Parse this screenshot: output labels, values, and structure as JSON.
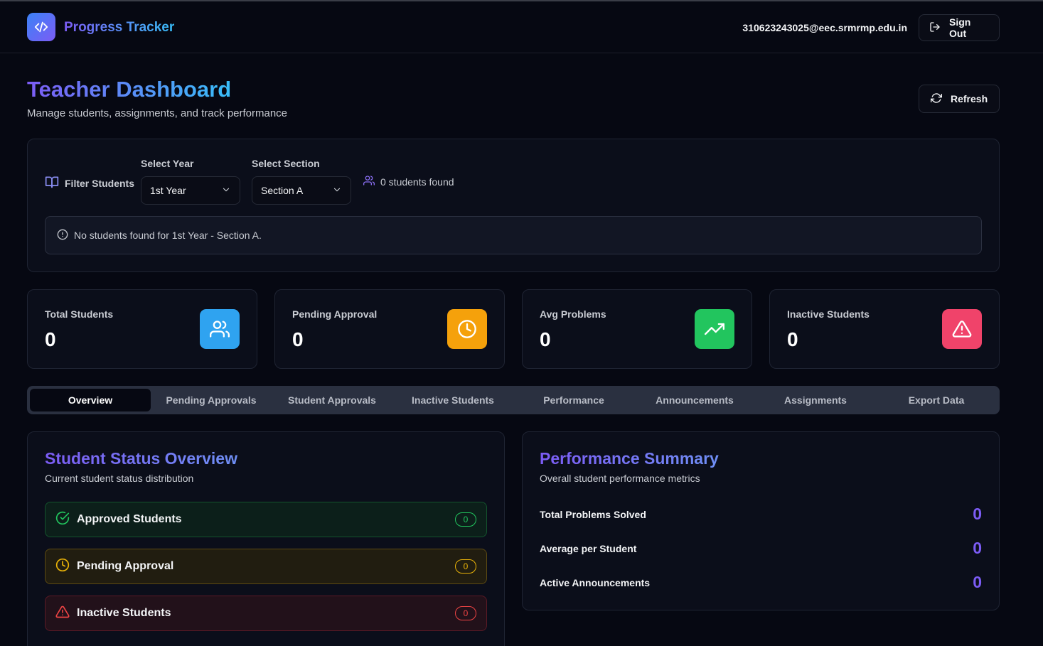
{
  "header": {
    "app_title": "Progress Tracker",
    "user_email": "310623243025@eec.srmrmp.edu.in",
    "sign_out_label": "Sign Out"
  },
  "page": {
    "title": "Teacher Dashboard",
    "subtitle": "Manage students, assignments, and track performance",
    "refresh_label": "Refresh"
  },
  "filter": {
    "label": "Filter Students",
    "year_label": "Select Year",
    "year_value": "1st Year",
    "section_label": "Select Section",
    "section_value": "Section A",
    "found_text": "0 students found",
    "alert_text": "No students found for 1st Year - Section A."
  },
  "stats": [
    {
      "label": "Total Students",
      "value": "0",
      "color": "#2fa3f0"
    },
    {
      "label": "Pending Approval",
      "value": "0",
      "color": "#f5a10b"
    },
    {
      "label": "Avg Problems",
      "value": "0",
      "color": "#22c55e"
    },
    {
      "label": "Inactive Students",
      "value": "0",
      "color": "#f0436a"
    }
  ],
  "tabs": [
    "Overview",
    "Pending Approvals",
    "Student Approvals",
    "Inactive Students",
    "Performance",
    "Announcements",
    "Assignments",
    "Export Data"
  ],
  "status_overview": {
    "title": "Student Status Overview",
    "subtitle": "Current student status distribution",
    "rows": [
      {
        "label": "Approved Students",
        "count": "0"
      },
      {
        "label": "Pending Approval",
        "count": "0"
      },
      {
        "label": "Inactive Students",
        "count": "0"
      }
    ]
  },
  "performance_summary": {
    "title": "Performance Summary",
    "subtitle": "Overall student performance metrics",
    "metrics": [
      {
        "label": "Total Problems Solved",
        "value": "0"
      },
      {
        "label": "Average per Student",
        "value": "0"
      },
      {
        "label": "Active Announcements",
        "value": "0"
      }
    ]
  },
  "colors": {
    "accent": "#7c5cf5",
    "background": "#060812"
  }
}
